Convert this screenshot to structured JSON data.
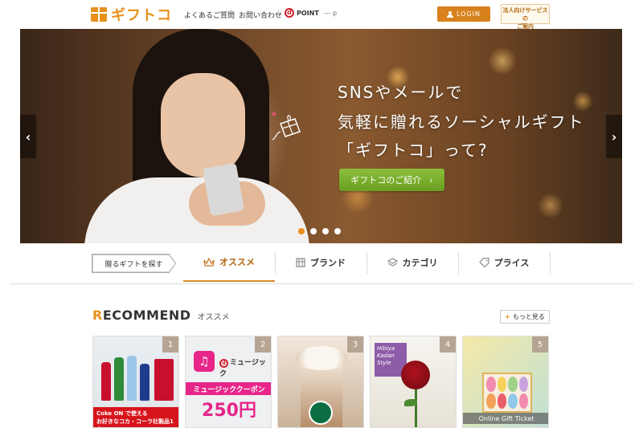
{
  "header": {
    "logo_text": "ギフトコ",
    "nav_faq": "よくあるご質問",
    "nav_contact": "お問い合わせ",
    "dpoint_mark": "d",
    "dpoint_label": "POINT",
    "dpoint_value": "--- p",
    "login_label": "LOGIN",
    "corp_line1": "法人向けサービスの",
    "corp_line2": "ご案内"
  },
  "hero": {
    "line1": "SNSやメールで",
    "line2": "気軽に贈れるソーシャルギフト",
    "line3": "「ギフトコ」って?",
    "cta_label": "ギフトコのご紹介",
    "cta_arrow": "›",
    "arrow_left": "‹",
    "arrow_right": "›",
    "slide_count": 4,
    "active_slide": 1
  },
  "catnav": {
    "search_label": "贈るギフトを探す",
    "tabs": [
      {
        "label": "オススメ",
        "icon": "crown-icon",
        "active": true
      },
      {
        "label": "ブランド",
        "icon": "building-icon",
        "active": false
      },
      {
        "label": "カテゴリ",
        "icon": "layers-icon",
        "active": false
      },
      {
        "label": "プライス",
        "icon": "tag-icon",
        "active": false
      }
    ]
  },
  "recommend": {
    "title_first": "R",
    "title_rest": "ECOMMEND",
    "subtitle": "オススメ",
    "more_plus": "+",
    "more_label": "もっと見る",
    "items": [
      {
        "rank": "1",
        "banner_line1": "Coke ON で使える",
        "banner_line2": "お好きなコカ・コーラ社製品1本"
      },
      {
        "rank": "2",
        "service": "ミュージック",
        "coupon": "ミュージッククーポン",
        "price": "250円"
      },
      {
        "rank": "3"
      },
      {
        "rank": "4",
        "badge": "Hibiya Kadan Style"
      },
      {
        "rank": "5",
        "label": "Online Gift Ticket"
      }
    ]
  },
  "colors": {
    "brand_orange": "#e8901a",
    "cta_green": "#7aae2c",
    "music_pink": "#e8268a",
    "coke_red": "#d7141c"
  }
}
